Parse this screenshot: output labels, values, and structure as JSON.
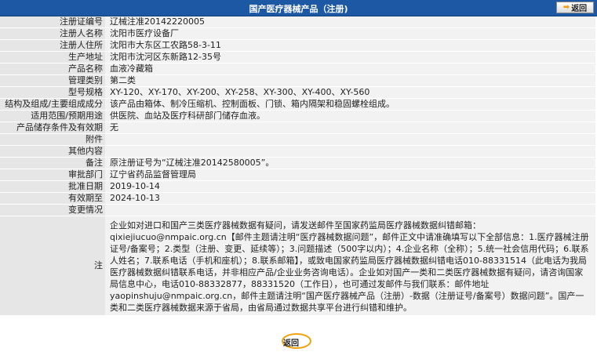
{
  "header": {
    "title": "国产医疗器械产品（注册)",
    "back_label": "返回"
  },
  "fields": [
    {
      "label": "注册证编号",
      "value": "辽械注准20142220005"
    },
    {
      "label": "注册人名称",
      "value": "沈阳市医疗设备厂"
    },
    {
      "label": "注册人住所",
      "value": "沈阳市大东区工农路58-3-11"
    },
    {
      "label": "生产地址",
      "value": "沈阳市沈河区东新路12-35号"
    },
    {
      "label": "产品名称",
      "value": "血液冷藏箱"
    },
    {
      "label": "管理类别",
      "value": "第二类"
    },
    {
      "label": "型号规格",
      "value": "XY-120、XY-170、XY-200、XY-258、XY-300、XY-400、XY-560"
    },
    {
      "label": "结构及组成/主要组成成分",
      "value": "该产品由箱体、制冷压缩机、控制面板、门锁、箱内隔架和稳固螺栓组成。"
    },
    {
      "label": "适用范围/预期用途",
      "value": "供医院、血站及医疗科研部门储存血液。"
    },
    {
      "label": "产品储存条件及有效期",
      "value": "无"
    },
    {
      "label": "附件",
      "value": ""
    },
    {
      "label": "其他内容",
      "value": ""
    },
    {
      "label": "备注",
      "value": "原注册证号为“辽械注准20142580005”。"
    },
    {
      "label": "审批部门",
      "value": "辽宁省药品监督管理局"
    },
    {
      "label": "批准日期",
      "value": "2019-10-14"
    },
    {
      "label": "有效期至",
      "value": "2024-10-13"
    },
    {
      "label": "变更情况",
      "value": ""
    }
  ],
  "note": {
    "label": "注",
    "text": "企业如对进口和国产三类医疗器械数据有疑问，请发送邮件至国家药监局医疗器械数据纠错邮箱：qixiejiucuo@nmpaic.org.cn【邮件主题请注明“医疗器械数据问题”，邮件正文中请准确填写以下全部信息：1.医疗器械注册证号/备案号；2.类型（注册、变更、延续等）；3.问题描述（500字以内）；4.企业名称（全称）；5.统一社会信用代码；6.联系人姓名；7.联系电话（手机和座机）；8.联系邮箱】，或致电国家药监局医疗器械数据纠错电话010-88331514（此电话为我局医疗器械数据纠错联系电话，并非相应产品/企业业务咨询电话）。企业如对国产一类和二类医疗器械数据有疑问，请咨询国家局信息中心，电话010-88332877，88331520（工作日），也可通过发邮件与我们联系：邮件地址yaopinshuju@nmpaic.org.cn，邮件主题请注明“国产医疗器械产品（注册）-数据（注册证号/备案号）数据问题”。国产一类和二类医疗器械数据来源于省局，由省局通过数据共享平台进行纠错和维护。"
  },
  "footer": {
    "return_label": "返回"
  }
}
